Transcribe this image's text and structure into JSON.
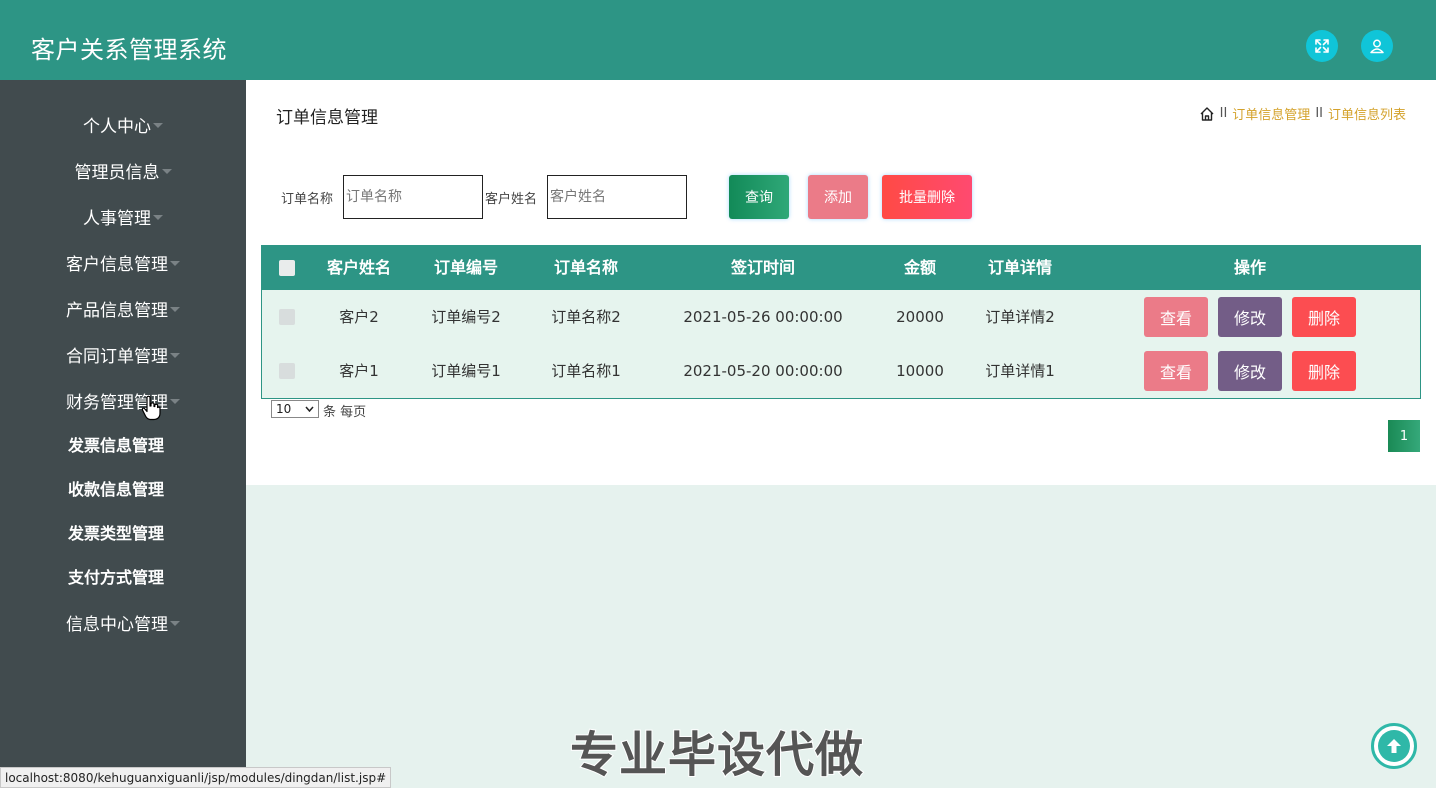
{
  "app": {
    "title": "客户关系管理系统"
  },
  "header": {
    "fullscreen_icon": "expand-icon",
    "user_icon": "user-icon"
  },
  "sidebar": {
    "items": [
      {
        "label": "个人中心",
        "has_caret": true
      },
      {
        "label": "管理员信息",
        "has_caret": true
      },
      {
        "label": "人事管理",
        "has_caret": true
      },
      {
        "label": "客户信息管理",
        "has_caret": true
      },
      {
        "label": "产品信息管理",
        "has_caret": true
      },
      {
        "label": "合同订单管理",
        "has_caret": true
      },
      {
        "label": "财务管理管理",
        "has_caret": true
      }
    ],
    "sub_items": [
      "发票信息管理",
      "收款信息管理",
      "发票类型管理",
      "支付方式管理"
    ],
    "last_item": {
      "label": "信息中心管理",
      "has_caret": true
    }
  },
  "page": {
    "title": "订单信息管理",
    "breadcrumb": {
      "home_icon": "home-icon",
      "separator": "II",
      "crumbs": [
        "订单信息管理",
        "订单信息列表"
      ]
    }
  },
  "search": {
    "order_name_label": "订单名称",
    "order_name_placeholder": "订单名称",
    "customer_name_label": "客户姓名",
    "customer_name_placeholder": "客户姓名",
    "query_label": "查询",
    "add_label": "添加",
    "batch_delete_label": "批量删除"
  },
  "table": {
    "columns": [
      "客户姓名",
      "订单编号",
      "订单名称",
      "签订时间",
      "金额",
      "订单详情",
      "操作"
    ],
    "rows": [
      {
        "customer": "客户2",
        "order_no": "订单编号2",
        "order_name": "订单名称2",
        "signed_at": "2021-05-26 00:00:00",
        "amount": "20000",
        "details": "订单详情2"
      },
      {
        "customer": "客户1",
        "order_no": "订单编号1",
        "order_name": "订单名称1",
        "signed_at": "2021-05-20 00:00:00",
        "amount": "10000",
        "details": "订单详情1"
      }
    ],
    "actions": {
      "view": "查看",
      "edit": "修改",
      "delete": "删除"
    }
  },
  "pagination": {
    "page_size": "10",
    "page_size_suffix": "条 每页",
    "current_page": "1"
  },
  "watermark": "专业毕设代做",
  "status_url": "localhost:8080/kehuguanxiguanli/jsp/modules/dingdan/list.jsp#",
  "colors": {
    "header": "#2d9585",
    "sidebar": "#414b4e",
    "view": "#eb7b88",
    "edit": "#735d87",
    "delete": "#fc4d51",
    "crumb": "#d4a22b"
  }
}
